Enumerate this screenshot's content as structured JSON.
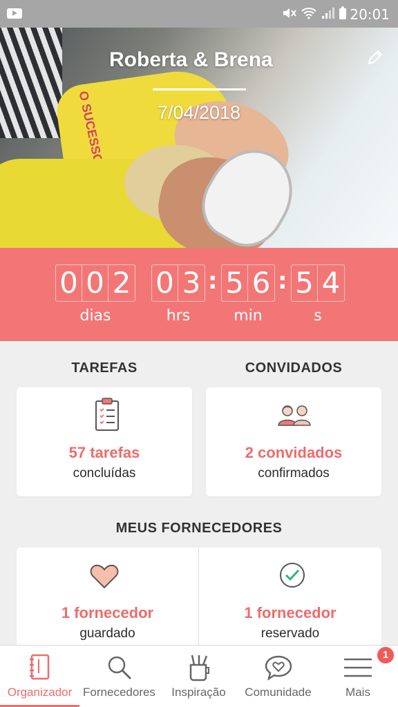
{
  "status_bar": {
    "time": "20:01"
  },
  "hero": {
    "names": "Roberta & Brena",
    "date": "7/04/2018",
    "shirt_print": "O SUCESSO é consequência da minha EXISTÊNCIA"
  },
  "countdown": {
    "days": [
      "0",
      "0",
      "2"
    ],
    "hours": [
      "0",
      "3"
    ],
    "minutes": [
      "5",
      "6"
    ],
    "seconds": [
      "5",
      "4"
    ],
    "labels": {
      "days": "dias",
      "hours": "hrs",
      "minutes": "min",
      "seconds": "s"
    }
  },
  "tarefas": {
    "title": "TAREFAS",
    "count": "57 tarefas",
    "caption": "concluídas"
  },
  "convidados": {
    "title": "CONVIDADOS",
    "count": "2 convidados",
    "caption": "confirmados"
  },
  "fornecedores": {
    "title": "MEUS FORNECEDORES",
    "saved": {
      "count": "1 fornecedor",
      "caption": "guardado"
    },
    "booked": {
      "count": "1 fornecedor",
      "caption": "reservado"
    }
  },
  "nav": {
    "items": [
      {
        "label": "Organizador",
        "icon": "notebook-icon"
      },
      {
        "label": "Fornecedores",
        "icon": "search-icon"
      },
      {
        "label": "Inspiração",
        "icon": "pencil-cup-icon"
      },
      {
        "label": "Comunidade",
        "icon": "chat-heart-icon"
      },
      {
        "label": "Mais",
        "icon": "menu-icon"
      }
    ],
    "badge": "1"
  },
  "colors": {
    "accent": "#f37676",
    "text_accent": "#ef6b6b"
  }
}
